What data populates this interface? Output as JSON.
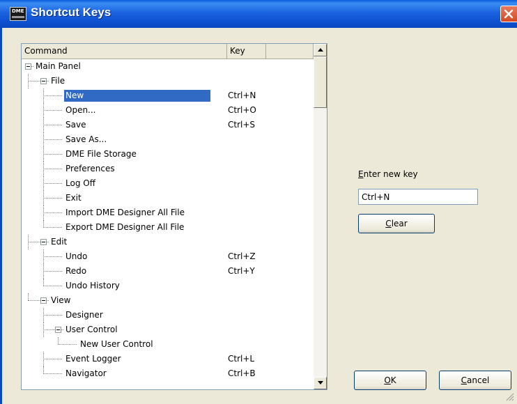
{
  "window": {
    "title": "Shortcut Keys",
    "icon_text": "DME"
  },
  "columns": [
    "Command",
    "Key"
  ],
  "tree": [
    {
      "label": "Main Panel",
      "level": 0,
      "expanded": true,
      "key": ""
    },
    {
      "label": "File",
      "level": 1,
      "expanded": true,
      "key": ""
    },
    {
      "label": "New",
      "level": 2,
      "key": "Ctrl+N",
      "selected": true
    },
    {
      "label": "Open...",
      "level": 2,
      "key": "Ctrl+O"
    },
    {
      "label": "Save",
      "level": 2,
      "key": "Ctrl+S"
    },
    {
      "label": "Save As...",
      "level": 2,
      "key": ""
    },
    {
      "label": "DME File Storage",
      "level": 2,
      "key": ""
    },
    {
      "label": "Preferences",
      "level": 2,
      "key": ""
    },
    {
      "label": "Log Off",
      "level": 2,
      "key": ""
    },
    {
      "label": "Exit",
      "level": 2,
      "key": ""
    },
    {
      "label": "Import DME Designer All File",
      "level": 2,
      "key": ""
    },
    {
      "label": "Export DME Designer All File",
      "level": 2,
      "key": ""
    },
    {
      "label": "Edit",
      "level": 1,
      "expanded": true,
      "key": ""
    },
    {
      "label": "Undo",
      "level": 2,
      "key": "Ctrl+Z"
    },
    {
      "label": "Redo",
      "level": 2,
      "key": "Ctrl+Y"
    },
    {
      "label": "Undo History",
      "level": 2,
      "key": ""
    },
    {
      "label": "View",
      "level": 1,
      "expanded": true,
      "key": ""
    },
    {
      "label": "Designer",
      "level": 2,
      "key": ""
    },
    {
      "label": "User Control",
      "level": 2,
      "expanded": true,
      "key": ""
    },
    {
      "label": "New User Control",
      "level": 3,
      "key": ""
    },
    {
      "label": "Event Logger",
      "level": 2,
      "key": "Ctrl+L"
    },
    {
      "label": "Navigator",
      "level": 2,
      "key": "Ctrl+B"
    }
  ],
  "new_key": {
    "label_first": "E",
    "label_rest": "nter new key",
    "value": "Ctrl+N"
  },
  "buttons": {
    "clear_first": "C",
    "clear_rest": "lear",
    "ok_first": "O",
    "ok_rest": "K",
    "cancel_first": "C",
    "cancel_rest": "ancel"
  },
  "colors": {
    "selection": "#316ac5",
    "titlebar": "#0a5bd8"
  }
}
